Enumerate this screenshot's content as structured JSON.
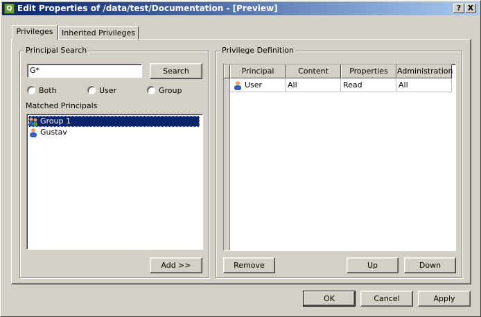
{
  "window": {
    "title": "Edit Properties of /data/test/Documentation - [Preview]",
    "help_glyph": "?",
    "close_glyph": "X",
    "app_icon": "app-leaf-icon"
  },
  "tabs": [
    {
      "label": "Privileges",
      "active": true
    },
    {
      "label": "Inherited Privileges",
      "active": false
    }
  ],
  "principal_search": {
    "group_label": "Principal Search",
    "search_value": "G*",
    "search_button": "Search",
    "radios": [
      {
        "label": "Both",
        "checked": false
      },
      {
        "label": "User",
        "checked": false
      },
      {
        "label": "Group",
        "checked": false
      }
    ],
    "matched_label": "Matched Principals",
    "matched": [
      {
        "name": "Group 1",
        "icon": "group-icon",
        "selected": true
      },
      {
        "name": "Gustav",
        "icon": "user-icon",
        "selected": false
      }
    ],
    "add_button": "Add >>"
  },
  "privilege_definition": {
    "group_label": "Privilege Definition",
    "columns": [
      "Principal",
      "Content",
      "Properties",
      "Administration"
    ],
    "rows": [
      {
        "principal": "User",
        "icon": "user-icon",
        "content": "All",
        "properties": "Read",
        "administration": "All"
      }
    ],
    "remove_button": "Remove",
    "up_button": "Up",
    "down_button": "Down"
  },
  "footer": {
    "ok": "OK",
    "cancel": "Cancel",
    "apply": "Apply"
  },
  "colors": {
    "title_gradient_start": "#0a246a",
    "title_gradient_end": "#a6caf0",
    "selection": "#0a246a",
    "face": "#d4d0c8"
  }
}
